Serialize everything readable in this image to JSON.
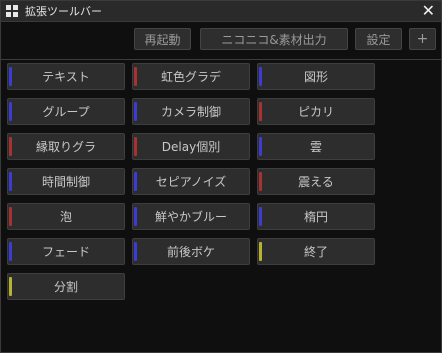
{
  "window": {
    "title": "拡張ツールバー",
    "close_label": "✕"
  },
  "topbar": {
    "buttons": [
      {
        "label": "再起動"
      },
      {
        "label": "ニコニコ&素材出力"
      },
      {
        "label": "設定"
      },
      {
        "label": "+"
      }
    ]
  },
  "colors": {
    "blue": "#3b3bd6",
    "red": "#a83232",
    "yellow": "#b8b32e"
  },
  "grid": {
    "buttons": [
      {
        "label": "テキスト",
        "color": "blue"
      },
      {
        "label": "虹色グラデ",
        "color": "red"
      },
      {
        "label": "図形",
        "color": "blue"
      },
      {
        "label": "グループ",
        "color": "blue"
      },
      {
        "label": "カメラ制御",
        "color": "blue"
      },
      {
        "label": "ピカリ",
        "color": "red"
      },
      {
        "label": "縁取りグラ",
        "color": "red"
      },
      {
        "label": "Delay個別",
        "color": "red"
      },
      {
        "label": "雲",
        "color": "blue"
      },
      {
        "label": "時間制御",
        "color": "blue"
      },
      {
        "label": "セピアノイズ",
        "color": "blue"
      },
      {
        "label": "震える",
        "color": "red"
      },
      {
        "label": "泡",
        "color": "red"
      },
      {
        "label": "鮮やかブルー",
        "color": "blue"
      },
      {
        "label": "楕円",
        "color": "blue"
      },
      {
        "label": "フェード",
        "color": "blue"
      },
      {
        "label": "前後ボケ",
        "color": "blue"
      },
      {
        "label": "終了",
        "color": "yellow"
      },
      {
        "label": "分割",
        "color": "yellow"
      }
    ]
  }
}
